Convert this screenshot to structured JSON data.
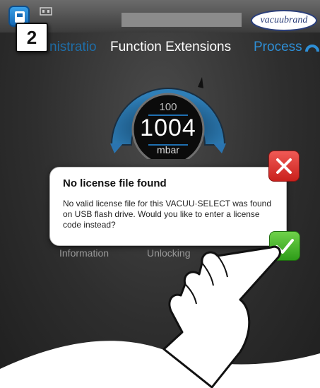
{
  "step_number": "2",
  "header": {
    "brand": "vacuubrand"
  },
  "tabs": {
    "administration": "nistratio",
    "function_extensions": "Function Extensions",
    "process": "Process"
  },
  "gauge": {
    "setpoint": "100",
    "value": "1004",
    "unit": "mbar"
  },
  "background_menu": {
    "information": "Information",
    "unlocking": "Unlocking"
  },
  "dialog": {
    "title": "No license file found",
    "message": "No valid license file for this VACUU·SELECT was found on USB flash drive. Would you like to enter a license code instead?"
  },
  "colors": {
    "accent_blue": "#2e8fd6",
    "cancel_red": "#d9302b",
    "confirm_green": "#3bab22"
  },
  "icons": {
    "home": "home-icon",
    "usb": "usb-icon",
    "close": "close-icon",
    "check": "check-icon",
    "process": "process-icon"
  }
}
